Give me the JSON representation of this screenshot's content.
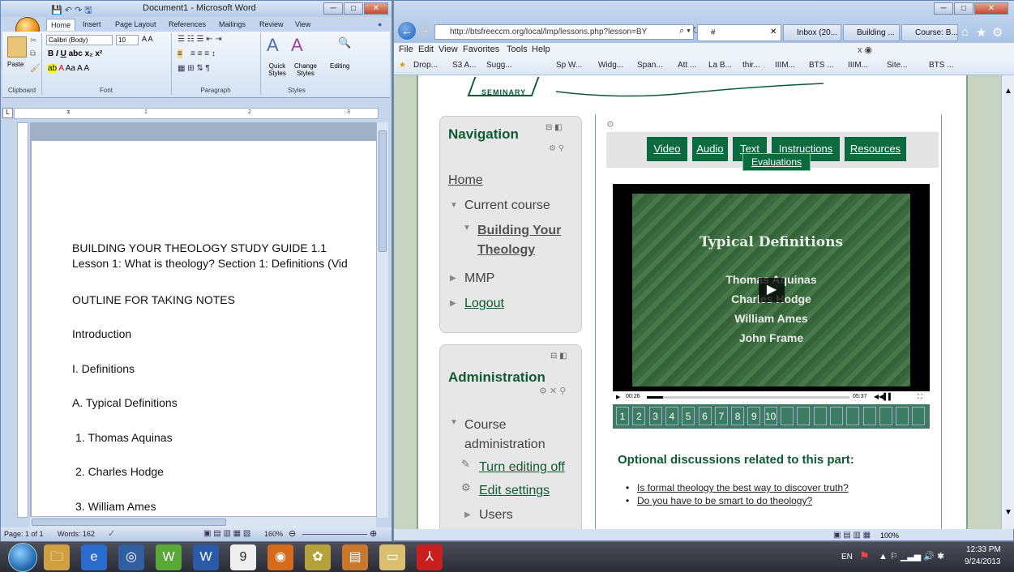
{
  "word": {
    "title": "Document1 - Microsoft Word",
    "tabs": [
      "Home",
      "Insert",
      "Page Layout",
      "References",
      "Mailings",
      "Review",
      "View"
    ],
    "font_name": "Calibri (Body)",
    "font_size": "10",
    "paste_label": "Paste",
    "groups": [
      "Clipboard",
      "Font",
      "Paragraph",
      "Styles"
    ],
    "quick_styles": "Quick Styles",
    "change_styles": "Change Styles",
    "editing": "Editing",
    "ruler_marks": [
      "1",
      "2",
      "3"
    ],
    "doc_lines": [
      "BUILDING YOUR THEOLOGY STUDY GUIDE 1.1",
      "Lesson 1: What is theology? Section 1: Definitions (Vid",
      "OUTLINE FOR TAKING NOTES",
      "Introduction",
      "I. Definitions",
      "A. Typical Definitions",
      " 1. Thomas Aquinas",
      " 2. Charles Hodge",
      " 3. William Ames"
    ],
    "status_page": "Page: 1 of 1",
    "status_words": "Words: 162",
    "zoom": "160%"
  },
  "ie": {
    "url": "http://btsfreeccm.org/local/lmp/lessons.php?lesson=BY",
    "tabs": [
      "#",
      "Inbox (20...",
      "Building ...",
      "Course: B..."
    ],
    "menu": [
      "File",
      "Edit",
      "View",
      "Favorites",
      "Tools",
      "Help"
    ],
    "favorites": [
      "Drop...",
      "S3 A...",
      "Sugg...",
      "Sp W...",
      "Widg...",
      "Span...",
      "Att ...",
      "La B...",
      "thir...",
      "IIIM...",
      "BTS ...",
      "IIIM...",
      "Site...",
      "BTS ..."
    ],
    "seminary_logo": "SEMINARY",
    "nav": {
      "title": "Navigation",
      "home": "Home",
      "current_course": "Current course",
      "course_name": "Building Your Theology",
      "mmp": "MMP",
      "logout": "Logout"
    },
    "admin": {
      "title": "Administration",
      "course_admin": "Course administration",
      "turn_editing": "Turn editing off",
      "edit_settings": "Edit settings",
      "users": "Users"
    },
    "lesson_tabs": [
      "Video",
      "Audio",
      "Text",
      "Instructions",
      "Resources"
    ],
    "tooltip": "Evaluations",
    "video": {
      "title": "Typical Definitions",
      "names": [
        "Thomas Aquinas",
        "Charles Hodge",
        "William Ames",
        "John Frame"
      ],
      "time_current": "00:26",
      "time_total": "05:37",
      "progress": 0.08
    },
    "page_numbers": [
      "1",
      "2",
      "3",
      "4",
      "5",
      "6",
      "7",
      "8",
      "9",
      "10"
    ],
    "discussions_heading": "Optional discussions related to this part:",
    "discussions": [
      "Is formal theology the best way to discover truth?",
      "Do you have to be smart to do theology?"
    ],
    "status_zoom": "100%"
  },
  "taskbar": {
    "lang": "EN",
    "time": "12:33 PM",
    "date": "9/24/2013",
    "calendar_day": "9"
  }
}
